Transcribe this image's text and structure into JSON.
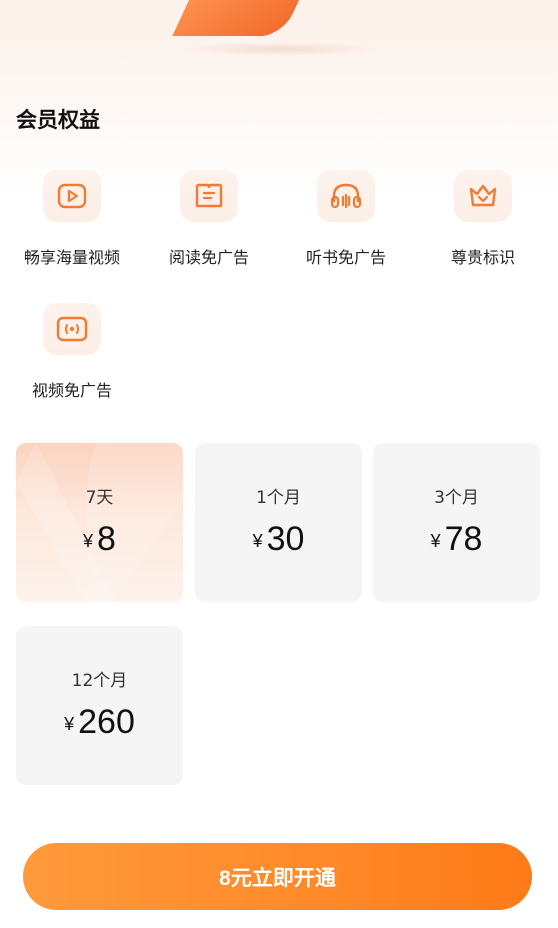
{
  "section_title": "会员权益",
  "benefits": [
    {
      "label": "畅享海量视频",
      "icon": "play-video-icon"
    },
    {
      "label": "阅读免广告",
      "icon": "book-icon"
    },
    {
      "label": "听书免广告",
      "icon": "headphones-icon"
    },
    {
      "label": "尊贵标识",
      "icon": "crown-icon"
    },
    {
      "label": "视频免广告",
      "icon": "video-signal-icon"
    }
  ],
  "plans": [
    {
      "period": "7天",
      "currency": "¥",
      "price": "8",
      "selected": true
    },
    {
      "period": "1个月",
      "currency": "¥",
      "price": "30",
      "selected": false
    },
    {
      "period": "3个月",
      "currency": "¥",
      "price": "78",
      "selected": false
    },
    {
      "period": "12个月",
      "currency": "¥",
      "price": "260",
      "selected": false
    }
  ],
  "cta_label": "8元立即开通",
  "colors": {
    "accent": "#f27a33",
    "cta_start": "#ff9a3c",
    "cta_end": "#ff7a18",
    "card_bg": "#f5f5f5"
  }
}
